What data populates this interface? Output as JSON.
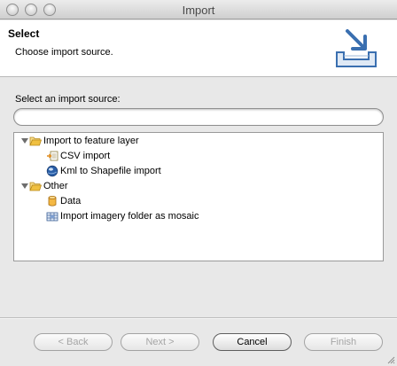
{
  "window": {
    "title": "Import"
  },
  "header": {
    "title": "Select",
    "description": "Choose import source."
  },
  "source": {
    "label": "Select an import source:",
    "filter_value": "",
    "filter_placeholder": ""
  },
  "tree": {
    "groups": [
      {
        "label": "Import to feature layer",
        "expanded": true,
        "icon": "folder-open-icon",
        "children": [
          {
            "label": "CSV import",
            "icon": "csv-import-icon"
          },
          {
            "label": "Kml to Shapefile import",
            "icon": "globe-icon"
          }
        ]
      },
      {
        "label": "Other",
        "expanded": true,
        "icon": "folder-open-icon",
        "children": [
          {
            "label": "Data",
            "icon": "database-icon"
          },
          {
            "label": "Import imagery folder as mosaic",
            "icon": "mosaic-grid-icon"
          }
        ]
      }
    ]
  },
  "buttons": {
    "back": {
      "label": "< Back",
      "enabled": false
    },
    "next": {
      "label": "Next >",
      "enabled": false
    },
    "cancel": {
      "label": "Cancel",
      "enabled": true
    },
    "finish": {
      "label": "Finish",
      "enabled": false
    }
  },
  "colors": {
    "folder": "#f0c040",
    "globe": "#2a5fa8",
    "database": "#e7a32a",
    "accent": "#3a6fb0"
  }
}
